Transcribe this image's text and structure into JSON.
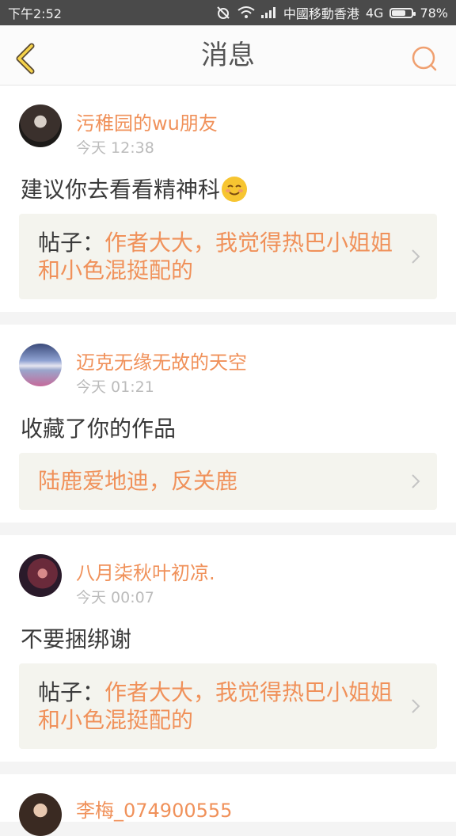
{
  "status_bar": {
    "time": "下午2:52",
    "carrier": "中國移動香港",
    "network": "4G",
    "battery": "78%",
    "battery_level": 0.78
  },
  "header": {
    "title": "消息"
  },
  "messages": [
    {
      "username": "污稚园的wu朋友",
      "time": "今天 12:38",
      "text": "建议你去看看精神科",
      "has_emoji": true,
      "ref_prefix": "帖子：",
      "ref_title": "作者大大，我觉得热巴小姐姐和小色混挺配的"
    },
    {
      "username": "迈克无缘无故的天空",
      "time": "今天 01:21",
      "text": "收藏了你的作品",
      "ref_prefix": "",
      "ref_title": "陆鹿爱地迪，反关鹿"
    },
    {
      "username": "八月柒秋叶初凉.",
      "time": "今天 00:07",
      "text": "不要捆绑谢",
      "ref_prefix": "帖子：",
      "ref_title": "作者大大，我觉得热巴小姐姐和小色混挺配的"
    },
    {
      "username": "李梅_074900555"
    }
  ],
  "colors": {
    "accent": "#f0915a",
    "status_bar": "#4a4a4a",
    "ref_background": "#f4f4ee"
  }
}
